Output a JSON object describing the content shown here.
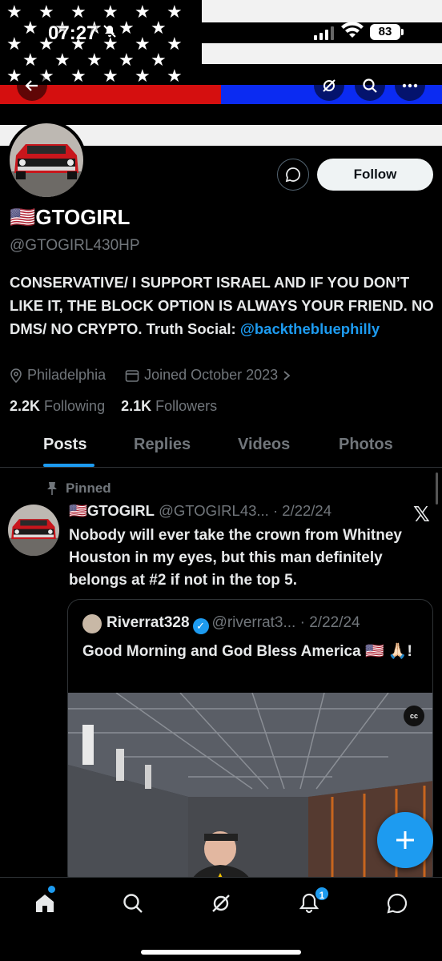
{
  "status_bar": {
    "time": "07:27",
    "battery": "83"
  },
  "profile": {
    "name": "🇺🇸GTOGIRL",
    "handle": "@GTOGIRL430HP",
    "bio_text": "CONSERVATIVE/ I SUPPORT ISRAEL AND IF YOU DON’T LIKE IT, THE BLOCK OPTION IS ALWAYS YOUR FRIEND. NO DMS/ NO CRYPTO. Truth Social: ",
    "bio_link": "@backthebluephilly",
    "location": "Philadelphia",
    "joined": "Joined October 2023",
    "following_count": "2.2K",
    "following_label": "Following",
    "followers_count": "2.1K",
    "followers_label": "Followers",
    "follow_label": "Follow"
  },
  "tabs": [
    {
      "label": "Posts",
      "active": true
    },
    {
      "label": "Replies"
    },
    {
      "label": "Videos"
    },
    {
      "label": "Photos"
    }
  ],
  "post": {
    "pinned_label": "Pinned",
    "author_name": "🇺🇸GTOGIRL",
    "author_meta": "@GTOGIRL43... · 2/22/24",
    "text": "Nobody will ever take the crown from Whitney Houston in my eyes, but this man definitely belongs at #2 if not in the top 5.",
    "quote": {
      "author_name": "Riverrat328",
      "author_meta": "@riverrat3... · 2/22/24",
      "text": "Good Morning and God Bless America 🇺🇸 🙏🏻!",
      "cc_label": "cc"
    }
  },
  "bottom_nav": {
    "notifications_badge": "1"
  },
  "colors": {
    "accent": "#1d9bf0",
    "background": "#000000",
    "muted": "#71767b"
  }
}
